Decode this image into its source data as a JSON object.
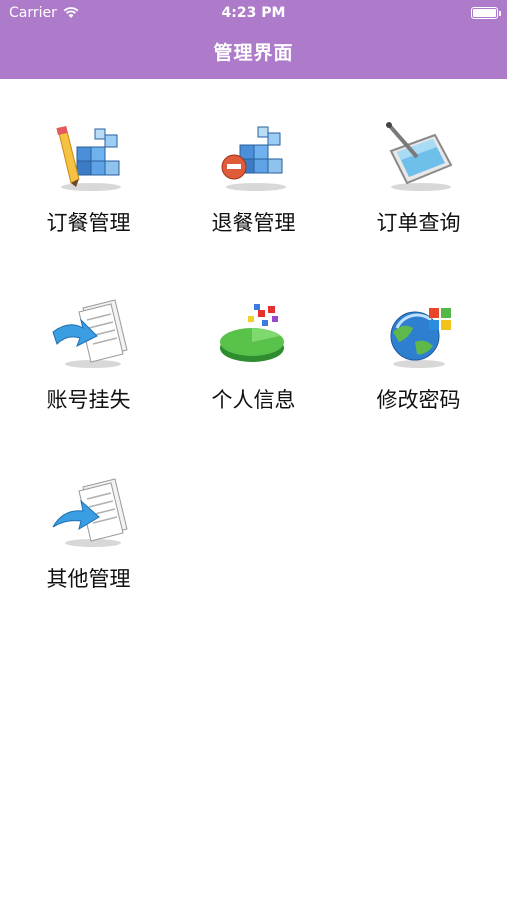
{
  "status_bar": {
    "carrier": "Carrier",
    "time": "4:23 PM"
  },
  "nav": {
    "title": "管理界面",
    "background": "#ae7bcb"
  },
  "menu": [
    {
      "label": "订餐管理",
      "icon": "cube-grid-pencil-icon"
    },
    {
      "label": "退餐管理",
      "icon": "cube-grid-remove-icon"
    },
    {
      "label": "订单查询",
      "icon": "tablet-stylus-icon"
    },
    {
      "label": "账号挂失",
      "icon": "document-arrow-icon"
    },
    {
      "label": "个人信息",
      "icon": "pie-chart-icon"
    },
    {
      "label": "修改密码",
      "icon": "globe-windows-icon"
    },
    {
      "label": "其他管理",
      "icon": "document-arrow-forward-icon"
    }
  ]
}
